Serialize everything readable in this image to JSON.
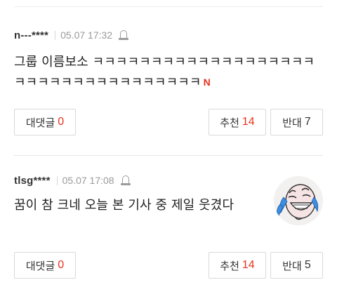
{
  "comments": [
    {
      "nickname": "n---****",
      "time": "05.07 17:32",
      "body": "그룹 이름보소 ㅋㅋㅋㅋㅋㅋㅋㅋㅋㅋㅋㅋㅋㅋㅋㅋㅋㅋㅋㅋㅋㅋㅋㅋㅋㅋㅋㅋㅋㅋㅋㅋㅋㅋㅋ",
      "new_badge": "N",
      "reply_label": "대댓글",
      "reply_count": "0",
      "like_label": "추천",
      "like_count": "14",
      "dislike_label": "반대",
      "dislike_count": "7"
    },
    {
      "nickname": "tlsg****",
      "time": "05.07 17:08",
      "body": "꿈이 참 크네 오늘 본 기사 중 제일 웃겼다",
      "has_avatar": true,
      "reply_label": "대댓글",
      "reply_count": "0",
      "like_label": "추천",
      "like_count": "14",
      "dislike_label": "반대",
      "dislike_count": "5"
    }
  ],
  "colors": {
    "accent_red": "#e8331e",
    "border": "#d9d9d9",
    "meta_gray": "#9a9a9a"
  },
  "icons": {
    "report": "report-bell-icon",
    "avatar": "laughing-face-avatar"
  }
}
